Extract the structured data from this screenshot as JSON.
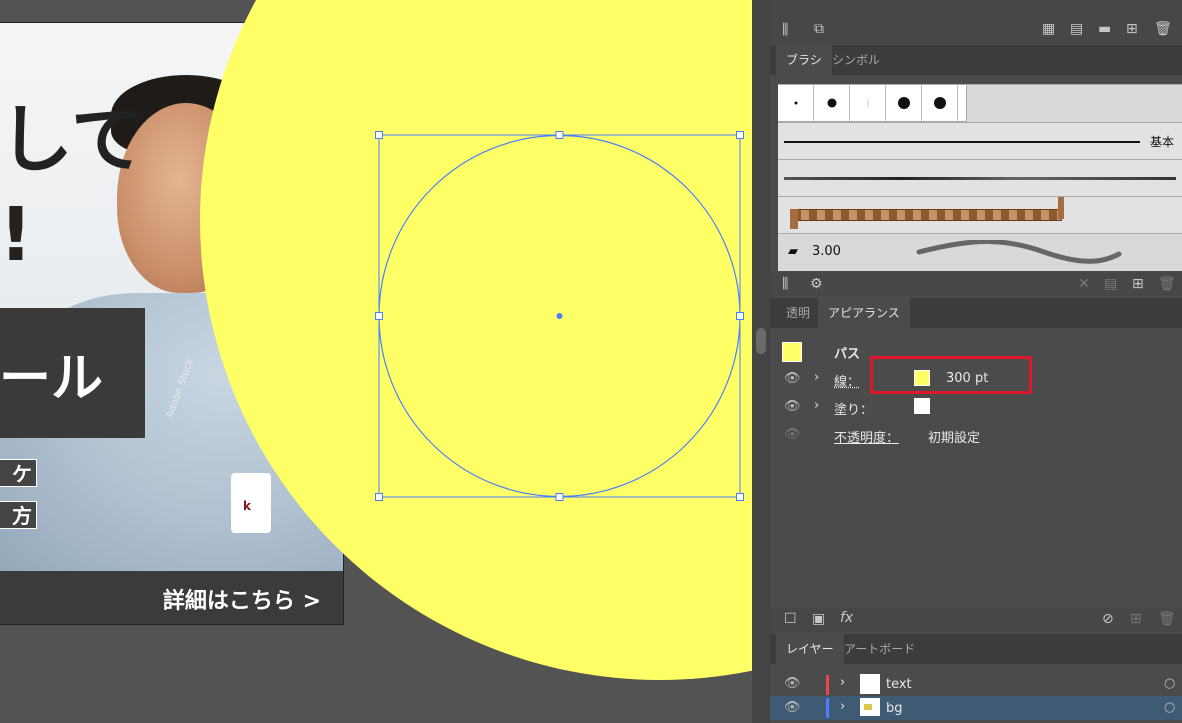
{
  "artboard": {
    "headline_line1": "して",
    "headline_line2": "!",
    "dark_label": "ール",
    "tag1": "ケ",
    "tag2": "方",
    "cta": "詳細はこちら >",
    "watermark": "Adobe Stock"
  },
  "colors": {
    "accent_yellow": "#ffff66",
    "selection_blue": "#4a7fff",
    "highlight_red": "#e0162b",
    "layer_text_red": "#e8474d",
    "layer_bg_blue": "#4a7fff"
  },
  "brushes_panel": {
    "tabs": [
      "ブラシ",
      "シンボル"
    ],
    "basic_label": "基本",
    "size_value": "3.00"
  },
  "appearance_panel": {
    "tabs": [
      "透明",
      "アピアランス"
    ],
    "object_type": "パス",
    "stroke_label": "線：",
    "stroke_value": "300 pt",
    "fill_label": "塗り：",
    "opacity_label": "不透明度：",
    "opacity_value": "初期設定"
  },
  "layers_panel": {
    "tabs": [
      "レイヤー",
      "アートボード"
    ],
    "layers": [
      {
        "name": "text"
      },
      {
        "name": "bg"
      }
    ]
  }
}
